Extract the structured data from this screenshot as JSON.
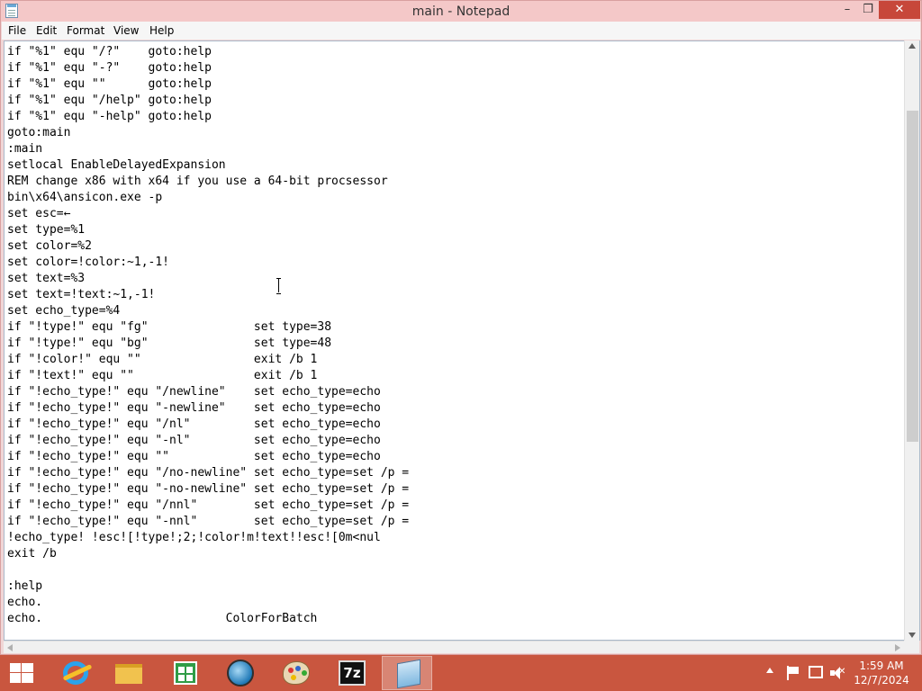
{
  "window": {
    "title": "main - Notepad",
    "minimize": "–",
    "maximize": "❐",
    "close": "✕"
  },
  "menu": {
    "file": "File",
    "edit": "Edit",
    "format": "Format",
    "view": "View",
    "help": "Help"
  },
  "editor": {
    "lines": [
      "if \"%1\" equ \"/?\"    goto:help",
      "if \"%1\" equ \"-?\"    goto:help",
      "if \"%1\" equ \"\"      goto:help",
      "if \"%1\" equ \"/help\" goto:help",
      "if \"%1\" equ \"-help\" goto:help",
      "goto:main",
      ":main",
      "setlocal EnableDelayedExpansion",
      "REM change x86 with x64 if you use a 64-bit procsessor",
      "bin\\x64\\ansicon.exe -p",
      "set esc=←",
      "set type=%1",
      "set color=%2",
      "set color=!color:~1,-1!",
      "set text=%3",
      "set text=!text:~1,-1!",
      "set echo_type=%4",
      "if \"!type!\" equ \"fg\"               set type=38",
      "if \"!type!\" equ \"bg\"               set type=48",
      "if \"!color!\" equ \"\"                exit /b 1",
      "if \"!text!\" equ \"\"                 exit /b 1",
      "if \"!echo_type!\" equ \"/newline\"    set echo_type=echo",
      "if \"!echo_type!\" equ \"-newline\"    set echo_type=echo",
      "if \"!echo_type!\" equ \"/nl\"         set echo_type=echo",
      "if \"!echo_type!\" equ \"-nl\"         set echo_type=echo",
      "if \"!echo_type!\" equ \"\"            set echo_type=echo",
      "if \"!echo_type!\" equ \"/no-newline\" set echo_type=set /p =",
      "if \"!echo_type!\" equ \"-no-newline\" set echo_type=set /p =",
      "if \"!echo_type!\" equ \"/nnl\"        set echo_type=set /p =",
      "if \"!echo_type!\" equ \"-nnl\"        set echo_type=set /p =",
      "!echo_type! !esc![!type!;2;!color!m!text!!esc![0m<nul",
      "exit /b",
      "",
      ":help",
      "echo.",
      "echo.                          ColorForBatch"
    ]
  },
  "taskbar": {
    "items": [
      {
        "name": "start",
        "icon": "windows-logo-icon"
      },
      {
        "name": "internet-explorer",
        "icon": "ie-icon"
      },
      {
        "name": "file-explorer",
        "icon": "folder-icon"
      },
      {
        "name": "store",
        "icon": "store-icon"
      },
      {
        "name": "globe-app",
        "icon": "globe-icon"
      },
      {
        "name": "paint",
        "icon": "paint-palette-icon"
      },
      {
        "name": "7zip",
        "icon": "7zip-icon",
        "label": "7z"
      },
      {
        "name": "notepad",
        "icon": "notepad-icon",
        "active": true
      }
    ],
    "clock": {
      "time": "1:59 AM",
      "date": "12/7/2024"
    }
  },
  "colors": {
    "titlebar": "#f4c8c8",
    "close_button": "#c7473a",
    "taskbar": "#c9563f",
    "desktop": "#f7c0c0"
  }
}
